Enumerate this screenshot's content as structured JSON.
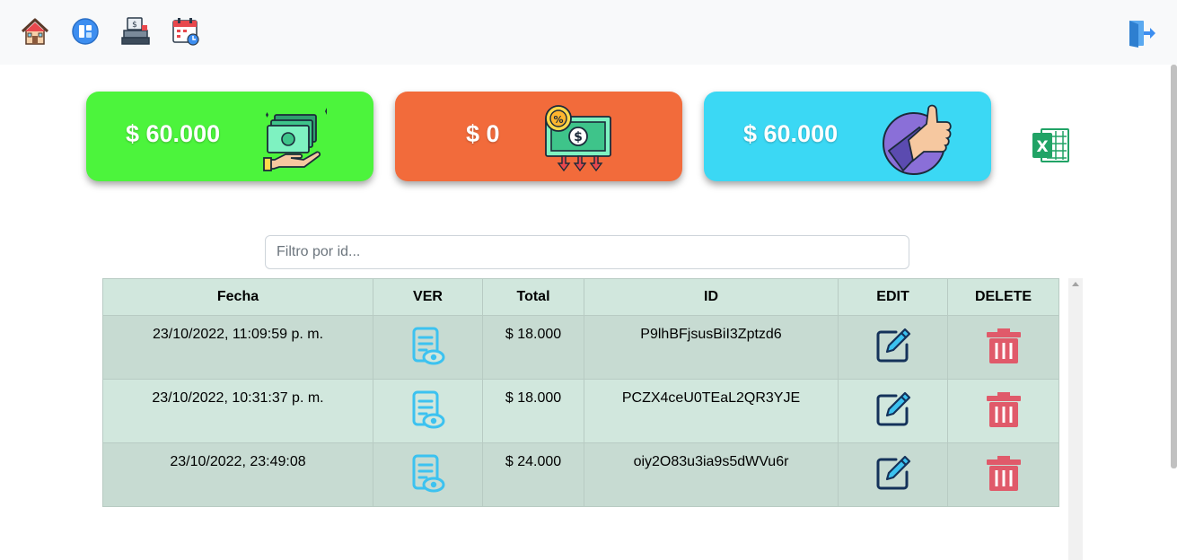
{
  "nav": {
    "icons": [
      "home-icon",
      "dashboard-icon",
      "cash-register-icon",
      "calendar-icon"
    ],
    "logout_icon": "logout-icon"
  },
  "cards": [
    {
      "amount": "$ 60.000",
      "color": "#4cf43c",
      "icon": "money-in-hand-icon"
    },
    {
      "amount": "$ 0",
      "color": "#f26b3b",
      "icon": "money-out-icon"
    },
    {
      "amount": "$ 60.000",
      "color": "#3bd8f4",
      "icon": "thumbs-up-icon"
    }
  ],
  "export_icon": "excel-icon",
  "search": {
    "placeholder": "Filtro por id...",
    "value": ""
  },
  "table": {
    "headers": [
      "Fecha",
      "VER",
      "Total",
      "ID",
      "EDIT",
      "DELETE"
    ],
    "rows": [
      {
        "fecha": "23/10/2022, 11:09:59 p. m.",
        "total": "$ 18.000",
        "id": "P9lhBFjsusBiI3Zptzd6"
      },
      {
        "fecha": "23/10/2022, 10:31:37 p. m.",
        "total": "$ 18.000",
        "id": "PCZX4ceU0TEaL2QR3YJE"
      },
      {
        "fecha": "23/10/2022, 23:49:08",
        "total": "$ 24.000",
        "id": "oiy2O83u3ia9s5dWVu6r"
      }
    ]
  }
}
